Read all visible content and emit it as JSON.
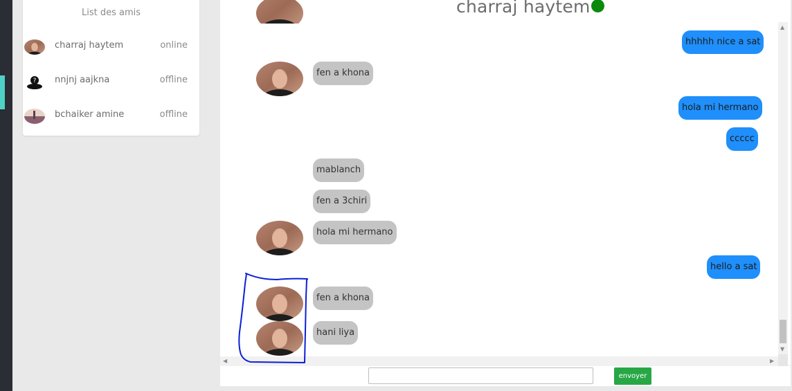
{
  "colors": {
    "online": "#0c8a0c",
    "outgoing_bubble": "#1f8ffb",
    "incoming_bubble": "#c4c4c4",
    "send_button": "#28a745",
    "rail_accent": "#4fd1c5",
    "annotation": "#0a1fd6"
  },
  "sidebar": {
    "title": "List des amis",
    "friends": [
      {
        "name": "charraj haytem",
        "status": "online",
        "avatar": "photo-avatar"
      },
      {
        "name": "nnjnj aajkna",
        "status": "offline",
        "avatar": "default-avatar"
      },
      {
        "name": "bchaiker amine",
        "status": "offline",
        "avatar": "landscape-avatar"
      }
    ]
  },
  "chat": {
    "contact_name": "charraj haytem",
    "contact_status": "online",
    "messages": [
      {
        "direction": "out",
        "text": "hhhhh nice a sat"
      },
      {
        "direction": "in",
        "text": "fen a khona"
      },
      {
        "direction": "out",
        "text": "hola mi hermano"
      },
      {
        "direction": "out",
        "text": "ccccc"
      },
      {
        "direction": "in",
        "text": "mablanch"
      },
      {
        "direction": "in",
        "text": "fen a 3chiri"
      },
      {
        "direction": "in",
        "text": "hola mi hermano"
      },
      {
        "direction": "out",
        "text": "hello a sat"
      },
      {
        "direction": "in",
        "text": "fen a khona"
      },
      {
        "direction": "in",
        "text": "hani liya"
      }
    ]
  },
  "composer": {
    "input_value": "",
    "placeholder": "",
    "send_label": "envoyer"
  }
}
